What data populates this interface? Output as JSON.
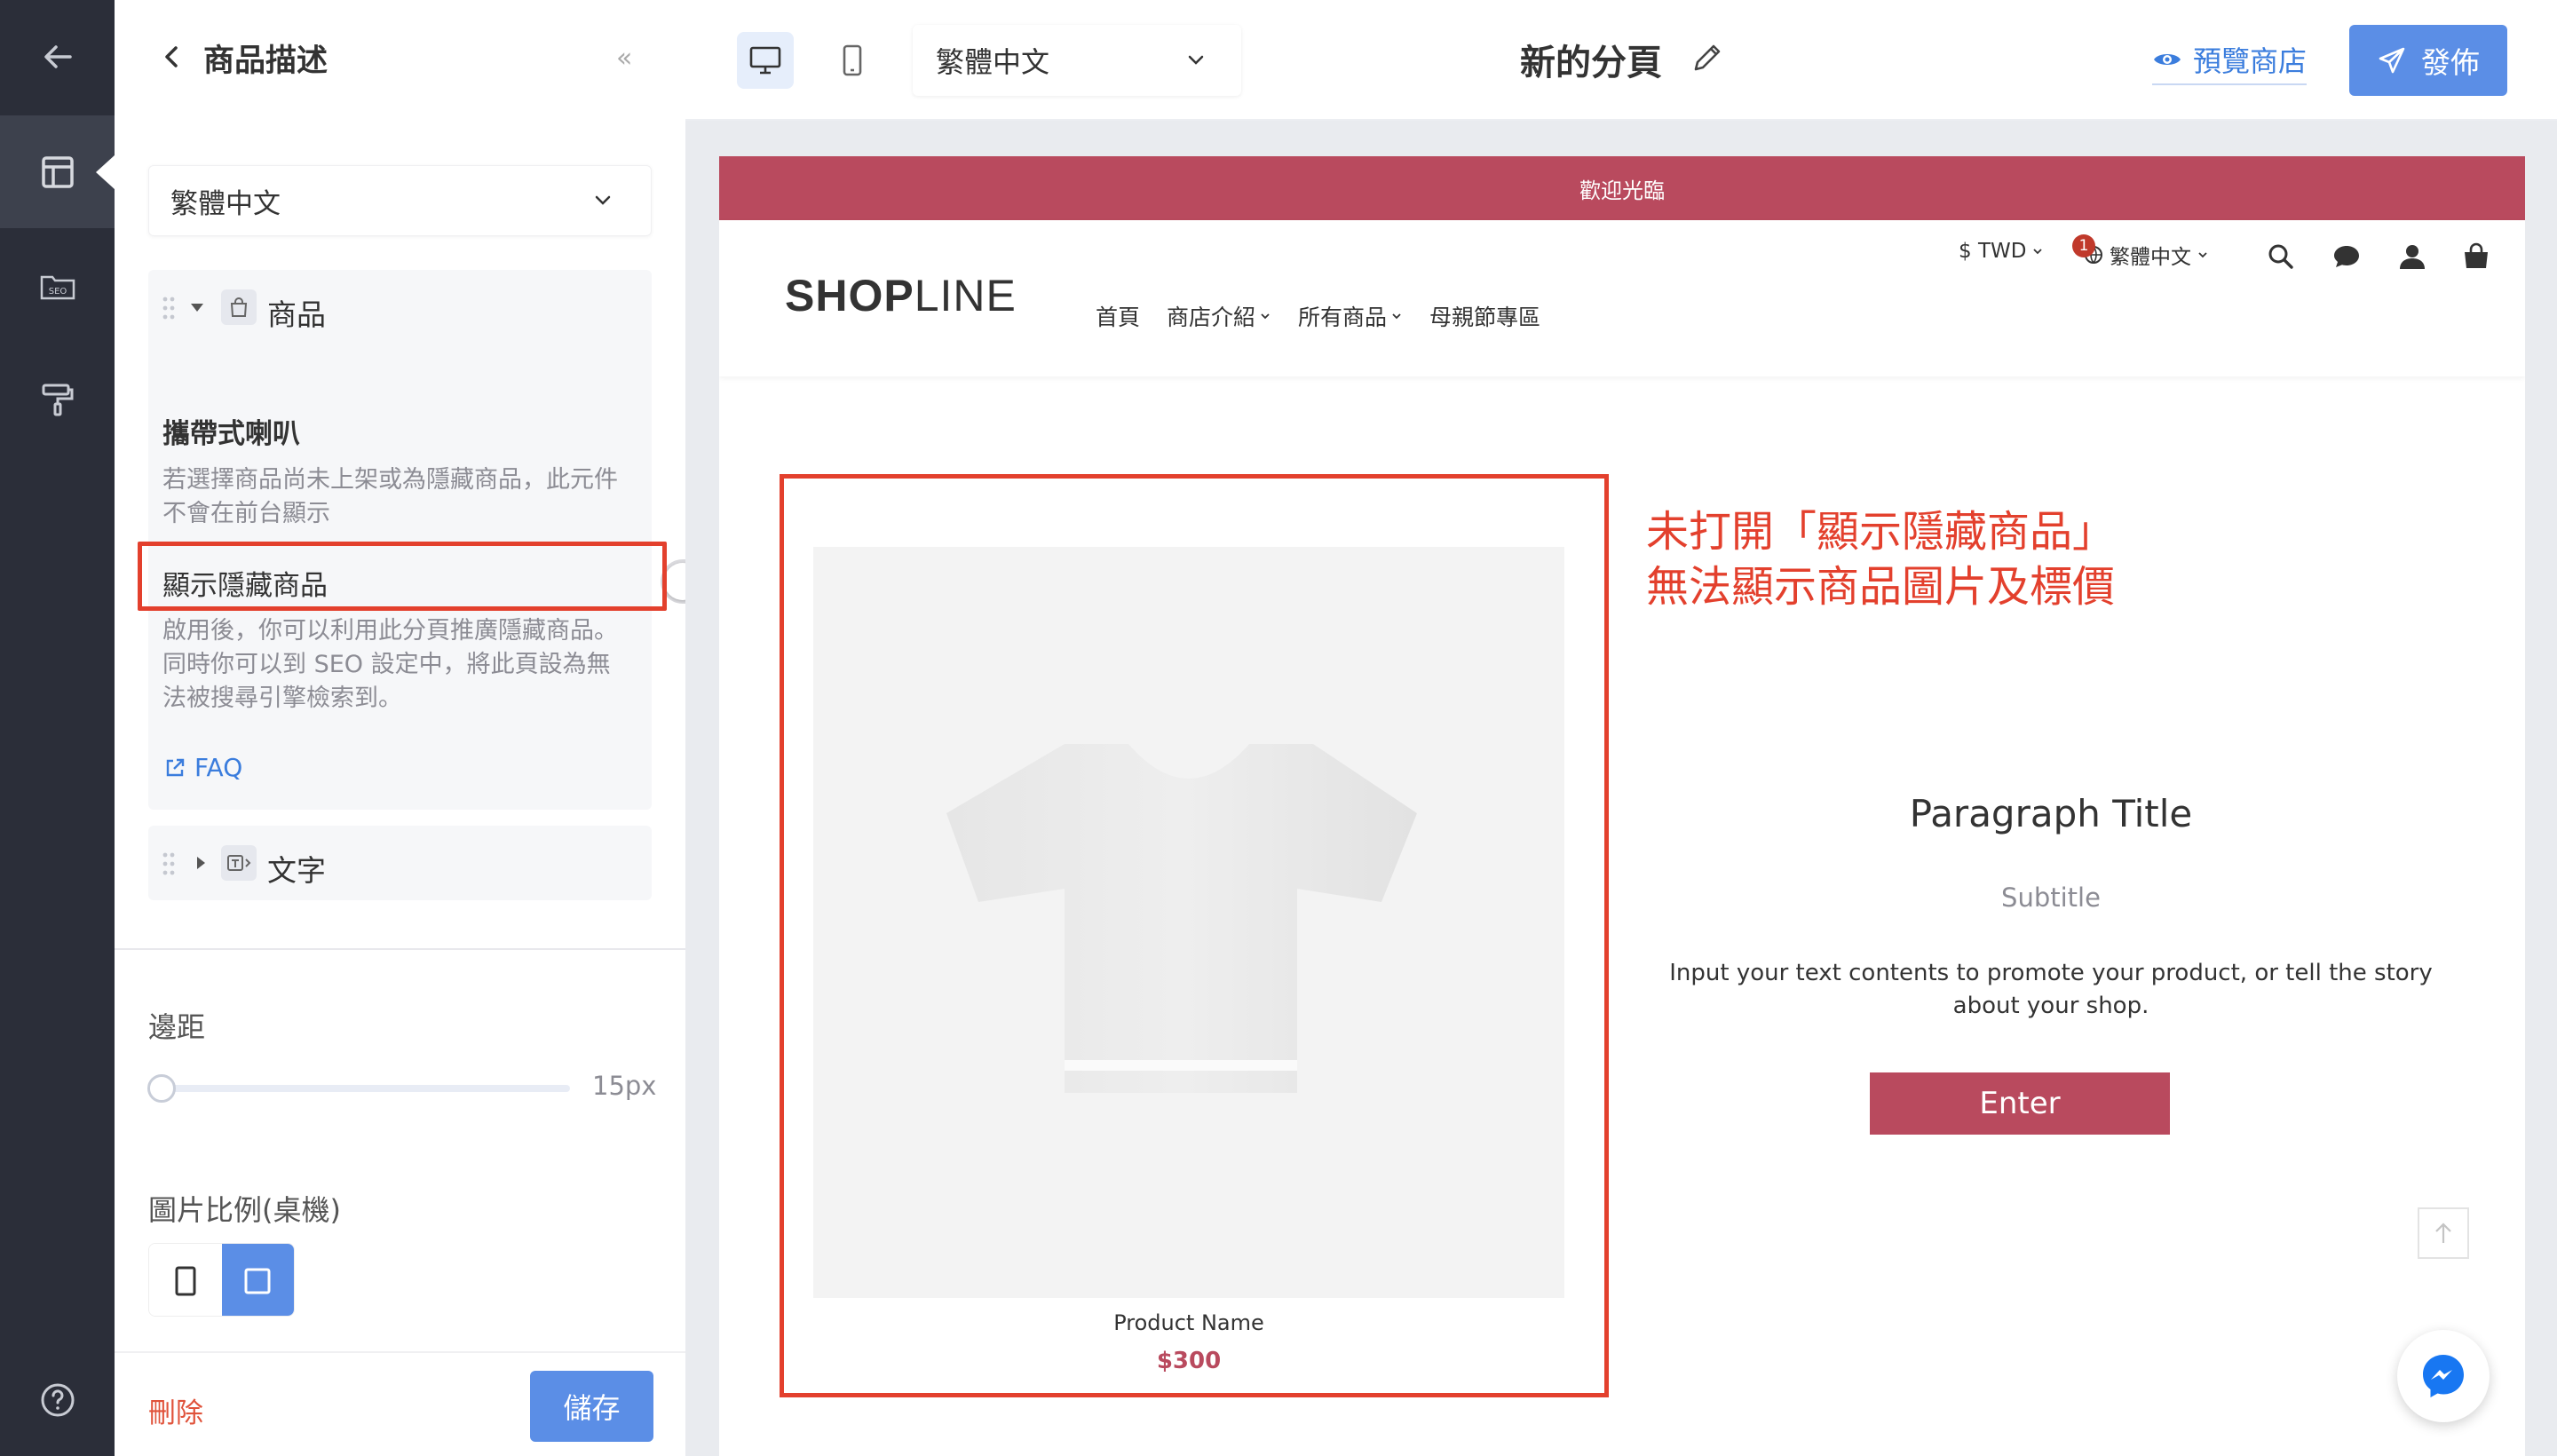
{
  "sidebar_rail": {
    "icons": [
      "back-arrow-icon",
      "layout-icon",
      "seo-icon",
      "paint-roller-icon",
      "help-icon"
    ],
    "seo_label": "SEO"
  },
  "panel": {
    "title": "商品描述",
    "language": "繁體中文",
    "product_block": {
      "label": "商品",
      "product_name": "攜帶式喇叭",
      "product_help": "若選擇商品尚未上架或為隱藏商品，此元件不會在前台顯示",
      "toggle_label": "顯示隱藏商品",
      "toggle_on": false,
      "toggle_help_1": "啟用後，你可以利用此分頁推廣隱藏商品。",
      "toggle_help_2": "同時你可以到 SEO 設定中，將此頁設為無法被搜尋引擎檢索到。",
      "faq": "FAQ"
    },
    "text_block": {
      "label": "文字"
    },
    "margin": {
      "label": "邊距",
      "value": "15px",
      "level": 0
    },
    "image_ratio": {
      "label": "圖片比例(桌機)",
      "options": [
        "portrait",
        "square"
      ],
      "selected": "square"
    },
    "delete_label": "刪除",
    "save_label": "儲存"
  },
  "topbar": {
    "language": "繁體中文",
    "page_title": "新的分頁",
    "preview_store": "預覽商店",
    "publish": "發佈"
  },
  "store": {
    "announcement": "歡迎光臨",
    "logo_bold": "SHOP",
    "logo_light": "LINE",
    "nav": [
      "首頁",
      "商店介紹",
      "所有商品",
      "母親節專區"
    ],
    "currency": "$ TWD",
    "language": "繁體中文",
    "cart_count": "1",
    "product": {
      "name": "Product Name",
      "price": "$300"
    },
    "annotation_line1": "未打開「顯示隱藏商品」",
    "annotation_line2": "無法顯示商品圖片及標價",
    "paragraph": {
      "title": "Paragraph Title",
      "subtitle": "Subtitle",
      "body": "Input your text contents to promote your product, or tell the story about your shop.",
      "button": "Enter"
    }
  },
  "colors": {
    "brand": "#b94a5e",
    "accent": "#5b8ee6",
    "annotation": "#e3402d",
    "rail": "#2b2e39"
  }
}
